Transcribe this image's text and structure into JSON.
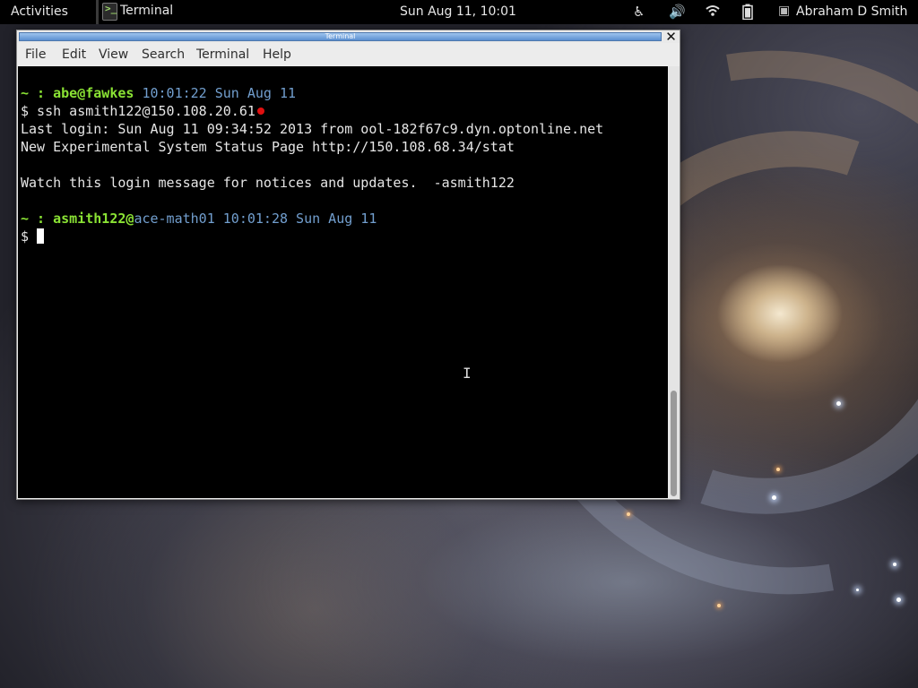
{
  "topbar": {
    "activities": "Activities",
    "app_menu": "Terminal",
    "clock": "Sun Aug 11, 10:01",
    "user": "Abraham D Smith",
    "icons": [
      "accessibility-icon",
      "volume-icon",
      "wifi-icon",
      "battery-icon",
      "user-status-icon"
    ]
  },
  "window": {
    "title": "Terminal",
    "menu": [
      "File",
      "Edit",
      "View",
      "Search",
      "Terminal",
      "Help"
    ]
  },
  "terminal": {
    "prompt1": {
      "tilde": "~ : ",
      "user_host": "abe@fawkes",
      "time": " 10:01:22 Sun Aug 11"
    },
    "cmd1": "$ ssh asmith122@150.108.20.61",
    "out1": "Last login: Sun Aug 11 09:34:52 2013 from ool-182f67c9.dyn.optonline.net",
    "out2": "New Experimental System Status Page http://150.108.68.34/stat",
    "out3": "Watch this login message for notices and updates.  -asmith122",
    "prompt2": {
      "tilde": "~ : ",
      "user": "asmith122@",
      "host": "ace-math01",
      "time": " 10:01:28 Sun Aug 11"
    },
    "ps": "$ "
  },
  "colors": {
    "prompt_green": "#8ae234",
    "prompt_blue": "#729fcf",
    "titlebar": "#5b8fd0"
  }
}
